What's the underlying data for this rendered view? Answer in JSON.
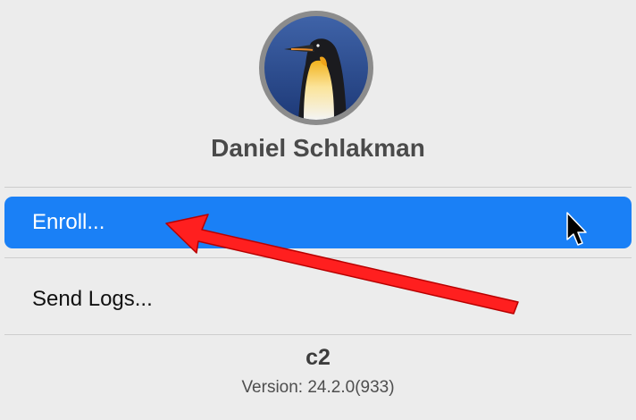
{
  "user": {
    "name": "Daniel Schlakman"
  },
  "menu": {
    "items": [
      {
        "label": "Enroll..."
      },
      {
        "label": "Send Logs..."
      }
    ],
    "selected_color": "#1a80f6"
  },
  "app": {
    "name": "c2",
    "version": "Version: 24.2.0(933)"
  },
  "annotation": {
    "arrow_color": "#ff1f1f",
    "arrow_icon": "red-arrow-icon",
    "cursor_icon": "mouse-pointer-icon"
  }
}
